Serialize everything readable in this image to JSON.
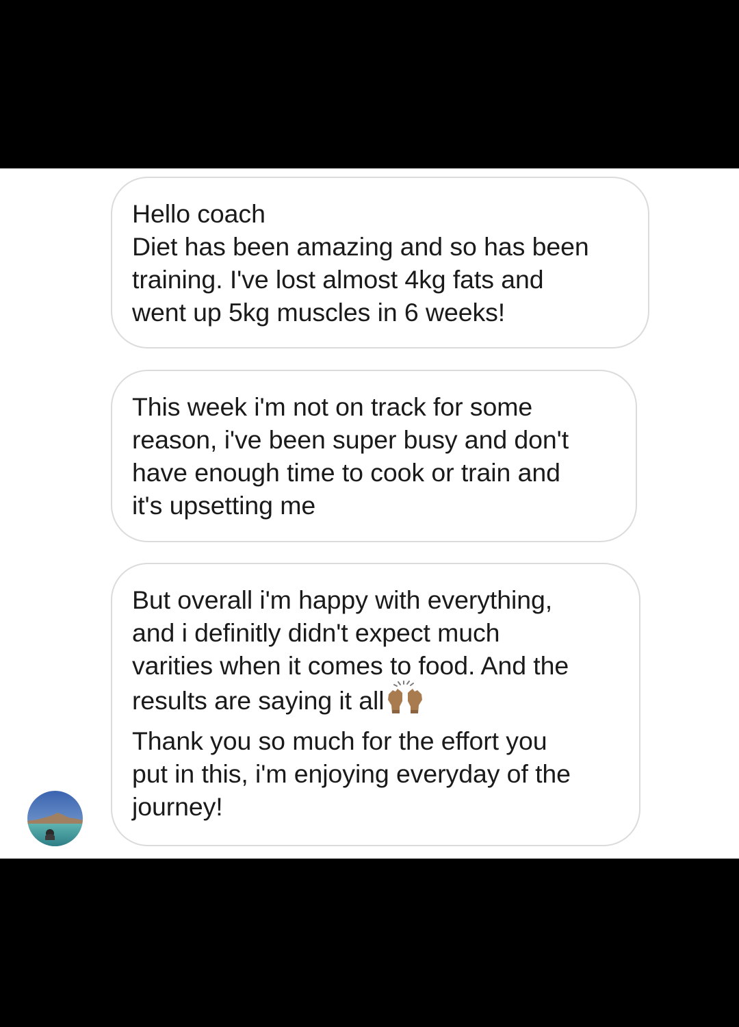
{
  "messages": [
    {
      "lines": [
        "Hello coach",
        "Diet has been amazing and so has been",
        "training. I've lost almost 4kg fats and",
        "went up 5kg muscles in 6 weeks!"
      ]
    },
    {
      "lines": [
        "This week i'm not on track for some",
        "reason, i've been super busy and don't",
        "have enough time to cook or train and",
        "it's upsetting me"
      ]
    },
    {
      "lines": [
        "But overall i'm happy with everything,",
        "and i definitly didn't expect much",
        "varities when it comes to food. And the",
        "results are saying it all",
        "Thank you so much for the effort you",
        "put in this, i'm enjoying everyday of the",
        "journey!"
      ],
      "emoji": "raising-hands-emoji"
    }
  ],
  "colors": {
    "bubble_border": "#dbdbdb",
    "text": "#1a1a1a",
    "background": "#ffffff",
    "frame": "#000000"
  }
}
